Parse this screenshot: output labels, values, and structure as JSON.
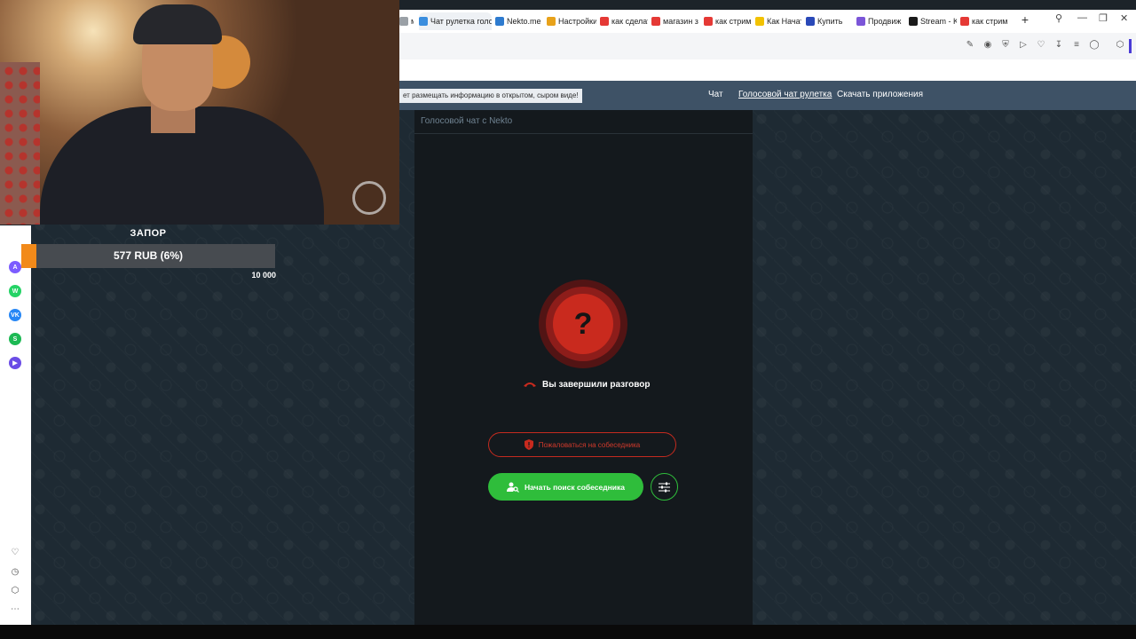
{
  "browser": {
    "tabs": [
      {
        "label": "ми",
        "fav_color": "#9aa0a6",
        "active": false
      },
      {
        "label": "Чат рулетка голос",
        "fav_color": "#3a8dde",
        "active": true
      },
      {
        "label": "Nekto.me",
        "fav_color": "#2e7bcf",
        "active": false
      },
      {
        "label": "Настройки",
        "fav_color": "#e8a21a",
        "active": false
      },
      {
        "label": "как сделат",
        "fav_color": "#e53935",
        "active": false
      },
      {
        "label": "магазин з",
        "fav_color": "#e53935",
        "active": false
      },
      {
        "label": "как стрим",
        "fav_color": "#e53935",
        "active": false
      },
      {
        "label": "Как Начат",
        "fav_color": "#f2c200",
        "active": false
      },
      {
        "label": "Купить",
        "fav_color": "#2a49b8",
        "active": false
      },
      {
        "label": "Продвиж",
        "fav_color": "#7b55d8",
        "active": false
      },
      {
        "label": "Stream - K",
        "fav_color": "#1a1a1a",
        "active": false
      },
      {
        "label": "как стрим",
        "fav_color": "#e53935",
        "active": false
      }
    ],
    "new_tab": "+",
    "toolbar_icons": [
      "edit-icon",
      "camera-icon",
      "shield-icon",
      "play-icon",
      "heart-icon",
      "download-icon",
      "menu-icon",
      "profile-icon",
      "extensions-icon"
    ]
  },
  "site": {
    "notice": "ет размещать информацию в открытом, сыром виде!",
    "nav": [
      {
        "label": "Чат",
        "current": false
      },
      {
        "label": "Голосовой чат рулетка",
        "current": true
      },
      {
        "label": "Скачать приложения",
        "current": false
      }
    ]
  },
  "chat": {
    "panel_title": "Голосовой чат с Nekto",
    "status_symbol": "?",
    "status_text": "Вы завершили разговор",
    "report_label": "Пожаловаться на собеседника",
    "search_label": "Начать поиск собеседника",
    "accent_red": "#c92a1e",
    "accent_green": "#2fbd3b"
  },
  "sidebar": {
    "apps": [
      {
        "name": "aria-icon",
        "color": "#7c5cff",
        "glyph": "A"
      },
      {
        "name": "whatsapp-icon",
        "color": "#25d366",
        "glyph": "W"
      },
      {
        "name": "vk-icon",
        "color": "#2787f5",
        "glyph": "VK"
      },
      {
        "name": "spotify-icon",
        "color": "#1db954",
        "glyph": "S"
      },
      {
        "name": "player-icon",
        "color": "#6b4de6",
        "glyph": "▶"
      }
    ],
    "bottom": [
      "heart-icon",
      "history-icon",
      "box-icon",
      "more-icon"
    ]
  },
  "overlay": {
    "goal_title": "ЗАПОР",
    "goal_text": "577 RUB (6%)",
    "goal_progress": 0.06,
    "goal_max": "10 000",
    "goal_color": "#f28a1a"
  }
}
